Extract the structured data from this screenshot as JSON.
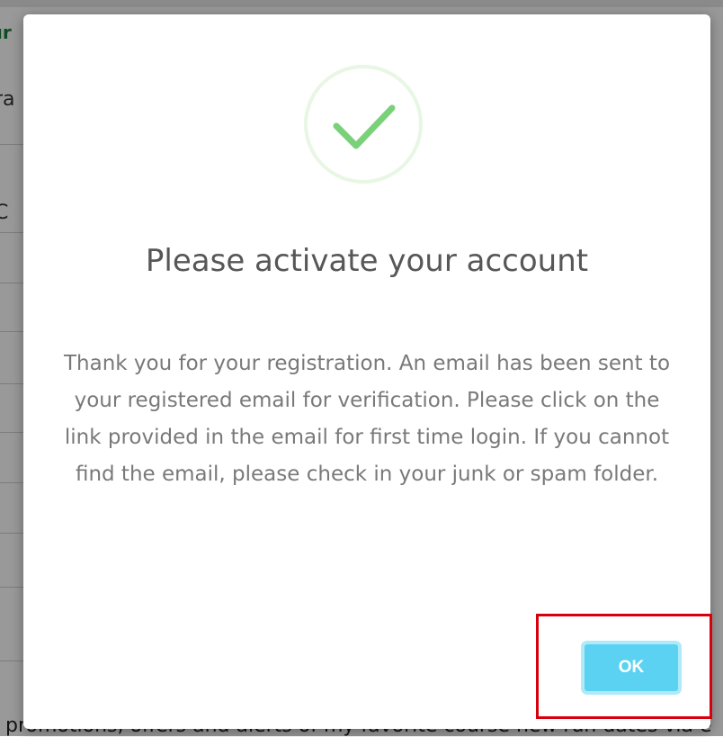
{
  "background_page": {
    "heading_fragment": "ır",
    "left_fragments": [
      "ra",
      "C"
    ],
    "bottom_text": "promotions, offers and alerts of my favorite course new run dates via e"
  },
  "modal": {
    "icon": "checkmark-icon",
    "title": "Please activate your account",
    "message": "Thank you for your registration. An email has been sent to your registered email for verification. Please click on the link provided in the email for first time login. If you cannot find the email, please check in your junk or spam folder.",
    "ok_label": "OK"
  },
  "colors": {
    "success_green": "#7ad17a",
    "ok_button": "#5bd2f2",
    "highlight_red": "#d8000c"
  }
}
